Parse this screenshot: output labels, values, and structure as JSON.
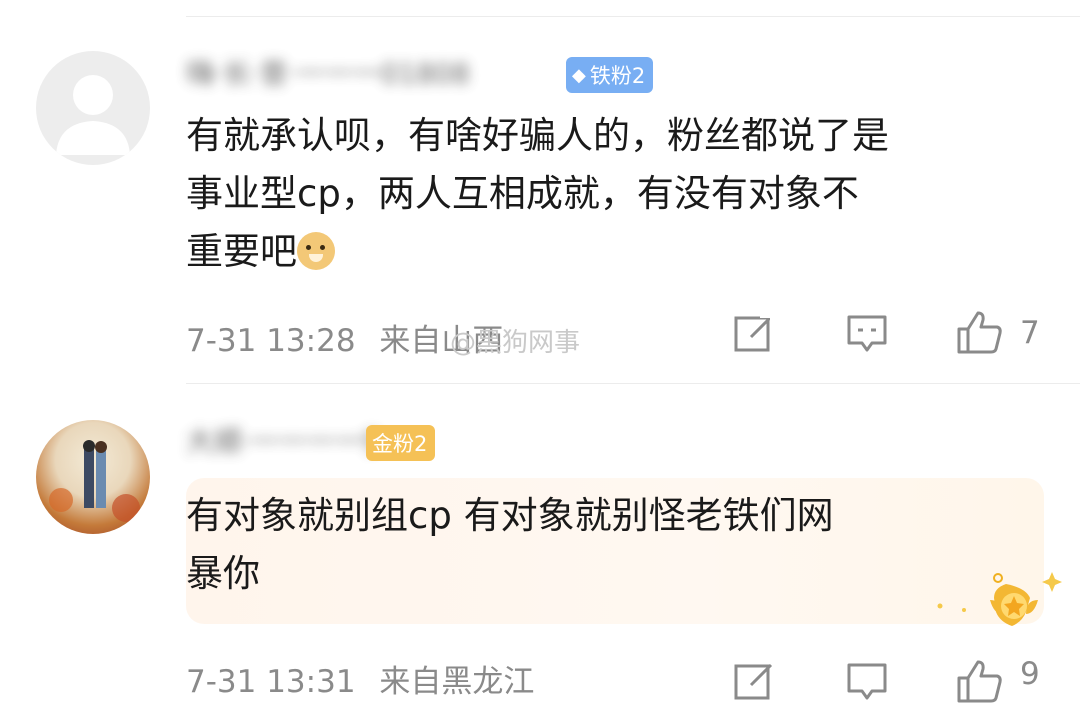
{
  "comments": [
    {
      "username": "嗨·长·昔·一一一01808",
      "badge": "铁粉2",
      "badge_color": "#78aef3",
      "content_lines": [
        "有就承认呗，有啥好骗人的，粉丝都说了是",
        "事业型cp，两人互相成就，有没有对象不",
        "重要吧"
      ],
      "emoji": "doge-emoji",
      "timestamp": "7-31 13:28",
      "location": "来自山西",
      "like_count": "7"
    },
    {
      "username": "大顺·一一一一9",
      "badge": "金粉2",
      "badge_color": "#f5c156",
      "content_lines": [
        "有对象就别组cp  有对象就别怪老铁们网",
        "暴你"
      ],
      "timestamp": "7-31 13:31",
      "location": "来自黑龙江",
      "like_count": "9"
    }
  ],
  "watermark": "@黑狗网事",
  "colors": {
    "text": "#1a1a1a",
    "meta": "#8a8a8a",
    "divider": "#ececec",
    "highlight": "#fff6ee"
  }
}
